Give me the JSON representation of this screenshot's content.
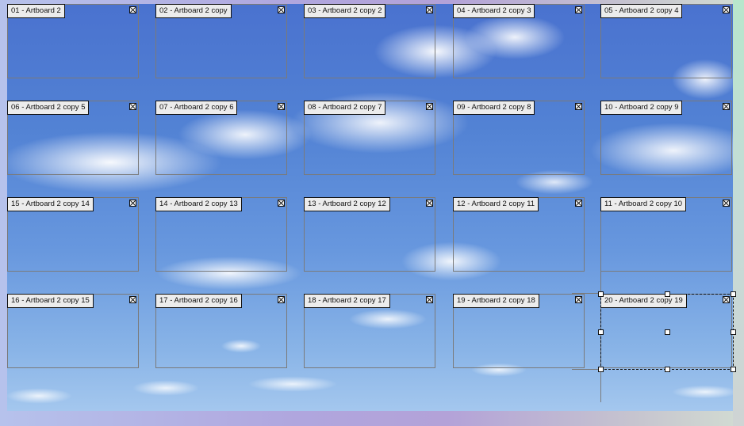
{
  "artboards": [
    {
      "label": "01 - Artboard 2"
    },
    {
      "label": "02 - Artboard 2 copy"
    },
    {
      "label": "03 - Artboard 2 copy 2"
    },
    {
      "label": "04 - Artboard 2 copy 3"
    },
    {
      "label": "05 - Artboard 2 copy 4"
    },
    {
      "label": "06 - Artboard 2 copy 5"
    },
    {
      "label": "07 - Artboard 2 copy 6"
    },
    {
      "label": "08 - Artboard 2 copy 7"
    },
    {
      "label": "09 - Artboard 2 copy 8"
    },
    {
      "label": "10 - Artboard 2 copy 9"
    },
    {
      "label": "15 - Artboard 2 copy 14"
    },
    {
      "label": "14 - Artboard 2 copy 13"
    },
    {
      "label": "13 - Artboard 2 copy 12"
    },
    {
      "label": "12 - Artboard 2 copy 11"
    },
    {
      "label": "11 - Artboard 2 copy 10"
    },
    {
      "label": "16 - Artboard 2 copy 15"
    },
    {
      "label": "17 - Artboard 2 copy 16"
    },
    {
      "label": "18 - Artboard 2 copy 17"
    },
    {
      "label": "19 - Artboard 2 copy 18"
    },
    {
      "label": "20 - Artboard 2 copy 19",
      "selected": true
    }
  ],
  "colors": {
    "label_bg": "#ececec",
    "border": "#7a7a7a",
    "selection": "#111111"
  }
}
